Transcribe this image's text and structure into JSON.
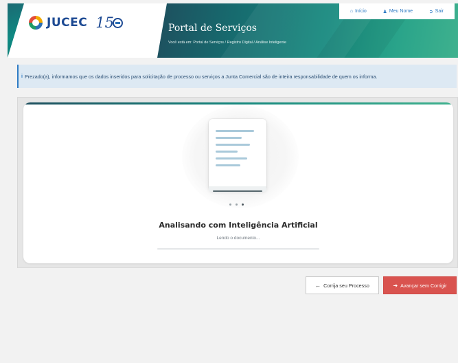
{
  "header": {
    "logo_text": "JUCEC",
    "logo_anniversary": "15",
    "portal_title": "Portal de Serviços",
    "breadcrumb": "Você está em: Portal de Serviços / Registro Digital / Análise Inteligente"
  },
  "topnav": {
    "items": [
      {
        "icon": "home-icon",
        "label": "Início"
      },
      {
        "icon": "user-icon",
        "label": "Meu Nome"
      },
      {
        "icon": "sign-out-icon",
        "label": "Sair"
      }
    ]
  },
  "alert": {
    "icon": "info-icon",
    "text": "Prezado(a), informamos que os dados inseridos para solicitação de processo ou serviços a Junta Comercial são de inteira responsabilidade de quem os informa."
  },
  "analysis": {
    "title": "Analisando com Inteligência Artificial",
    "status": "Lendo o documento...",
    "progress": 0
  },
  "actions": {
    "fix_label": "Corrija seu Processo",
    "advance_label": "Avançar sem Corrigir"
  },
  "colors": {
    "accent": "#2f7bc4",
    "danger": "#d9534f",
    "header_teal": "#16887e"
  }
}
